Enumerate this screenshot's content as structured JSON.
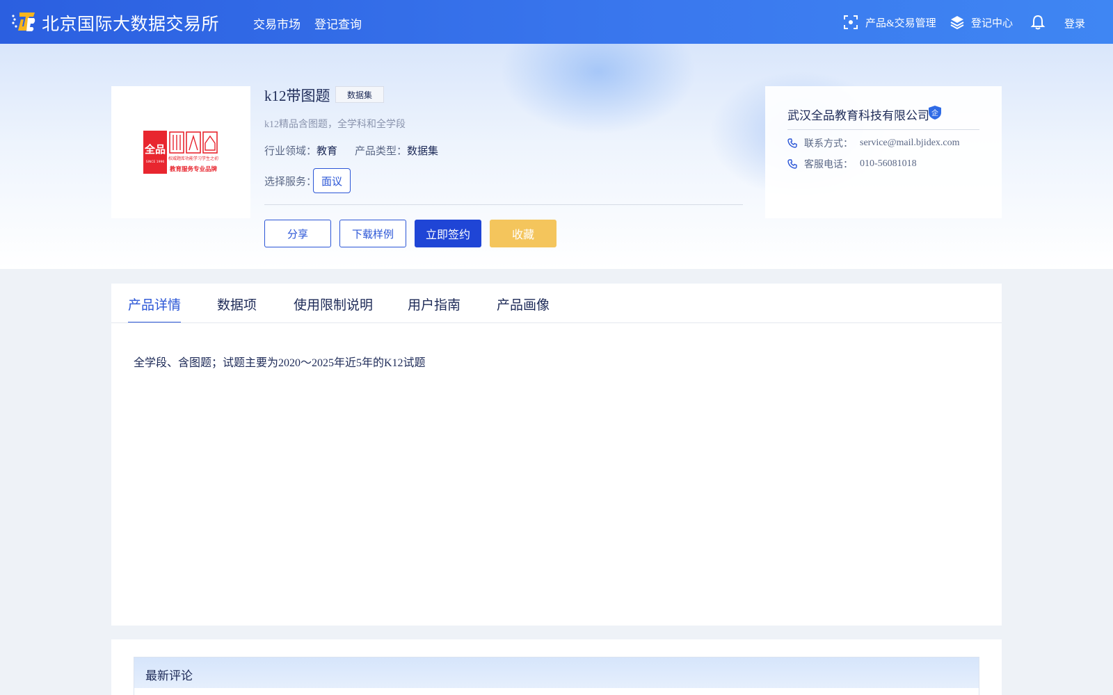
{
  "header": {
    "brand": "北京国际大数据交易所",
    "nav": [
      "交易市场",
      "登记查询"
    ],
    "product_mgmt": "产品&交易管理",
    "register_center": "登记中心",
    "login": "登录"
  },
  "product": {
    "title": "k12带图题",
    "tag": "数据集",
    "subtitle": "k12精品含图题，全学科和全学段",
    "industry_label": "行业领域：",
    "industry_value": "教育",
    "type_label": "产品类型：",
    "type_value": "数据集",
    "service_label": "选择服务：",
    "service_option": "面议",
    "logo_text": {
      "main": "全品",
      "tagline1": "权威题库",
      "tagline2": "功能学习",
      "tagline3": "学生之初",
      "since": "SINCE 1996",
      "slogan": "教育服务专业品牌"
    }
  },
  "actions": {
    "share": "分享",
    "download": "下载样例",
    "sign": "立即签约",
    "favorite": "收藏"
  },
  "company": {
    "name": "武汉全品教育科技有限公司",
    "badge": "企",
    "contact_label": "联系方式：",
    "contact_value": "service@mail.bjidex.com",
    "phone_label": "客服电话：",
    "phone_value": "010-56081018"
  },
  "tabs": [
    "产品详情",
    "数据项",
    "使用限制说明",
    "用户指南",
    "产品画像"
  ],
  "active_tab": "产品详情",
  "detail_text": "全学段、含图题；试题主要为2020～2025年近5年的K12试题",
  "comments": {
    "title": "最新评论"
  },
  "colors": {
    "primary": "#1f45d6",
    "accent_yellow": "#f4c55c",
    "logo_red": "#e8262f"
  }
}
